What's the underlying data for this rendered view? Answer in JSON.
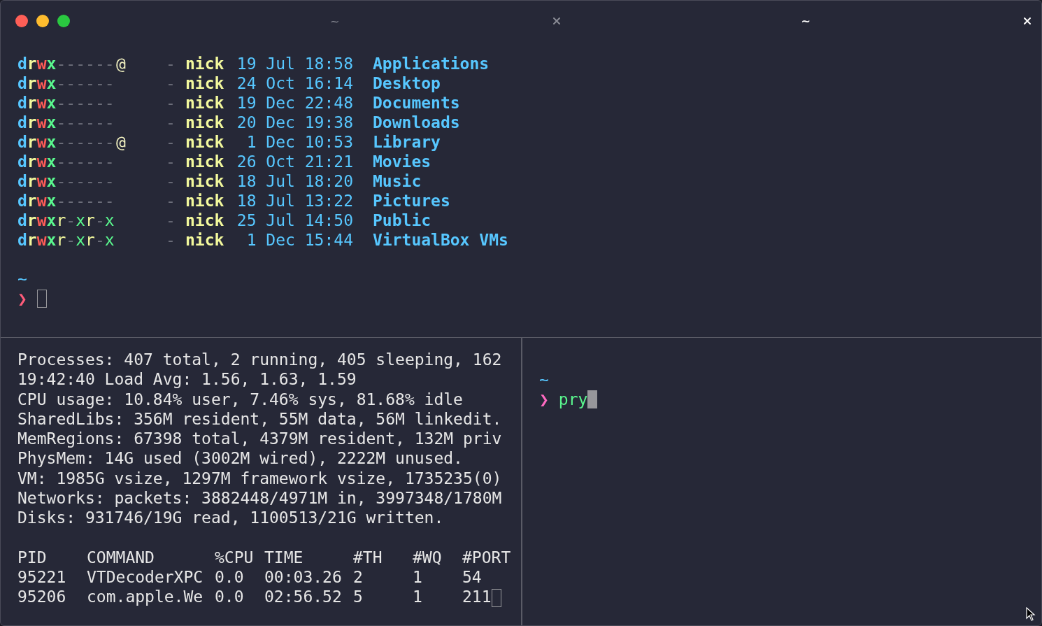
{
  "tabs": [
    {
      "title": "~",
      "selected": false
    },
    {
      "title": "~",
      "selected": true
    }
  ],
  "top_pane": {
    "listing": [
      {
        "permissions": "drwx------",
        "xattr": "@",
        "size": "-",
        "user": "nick",
        "date": "19 Jul 18:58",
        "name": "Applications"
      },
      {
        "permissions": "drwx------",
        "size": "-",
        "user": "nick",
        "date": "24 Oct 16:14",
        "name": "Desktop"
      },
      {
        "permissions": "drwx------",
        "size": "-",
        "user": "nick",
        "date": "19 Dec 22:48",
        "name": "Documents"
      },
      {
        "permissions": "drwx------",
        "size": "-",
        "user": "nick",
        "date": "20 Dec 19:38",
        "name": "Downloads"
      },
      {
        "permissions": "drwx------",
        "xattr": "@",
        "size": "-",
        "user": "nick",
        "date": "1 Dec 10:53",
        "name": "Library"
      },
      {
        "permissions": "drwx------",
        "size": "-",
        "user": "nick",
        "date": "26 Oct 21:21",
        "name": "Movies"
      },
      {
        "permissions": "drwx------",
        "size": "-",
        "user": "nick",
        "date": "18 Jul 18:20",
        "name": "Music"
      },
      {
        "permissions": "drwx------",
        "size": "-",
        "user": "nick",
        "date": "18 Jul 13:22",
        "name": "Pictures"
      },
      {
        "permissions": "drwxr-xr-x",
        "size": "-",
        "user": "nick",
        "date": "25 Jul 14:50",
        "name": "Public"
      },
      {
        "permissions": "drwxr-xr-x",
        "size": "-",
        "user": "nick",
        "date": "1 Dec 15:44",
        "name": "VirtualBox VMs"
      }
    ],
    "cwd": "~",
    "prompt": "❯",
    "focused": false
  },
  "bottom_left_pane": {
    "summary": [
      "Processes: 407 total, 2 running, 405 sleeping, 162",
      "19:42:40 Load Avg: 1.56, 1.63, 1.59",
      "CPU usage: 10.84% user, 7.46% sys, 81.68% idle",
      "SharedLibs: 356M resident, 55M data, 56M linkedit.",
      "MemRegions: 67398 total, 4379M resident, 132M priv",
      "PhysMem: 14G used (3002M wired), 2222M unused.",
      "VM: 1985G vsize, 1297M framework vsize, 1735235(0)",
      "Networks: packets: 3882448/4971M in, 3997348/1780M",
      "Disks: 931746/19G read, 1100513/21G written."
    ],
    "table": {
      "columns": [
        "PID",
        "COMMAND",
        "%CPU",
        "TIME",
        "#TH",
        "#WQ",
        "#PORT"
      ],
      "rows": [
        [
          "95221",
          "VTDecoderXPC",
          "0.0",
          "00:03.26",
          "2",
          "1",
          "54"
        ],
        [
          "95206",
          "com.apple.We",
          "0.0",
          "02:56.52",
          "5",
          "1",
          "211"
        ]
      ]
    },
    "focused": false
  },
  "bottom_right_pane": {
    "cwd": "~",
    "prompt": "❯",
    "command": "pry",
    "focused": true
  }
}
